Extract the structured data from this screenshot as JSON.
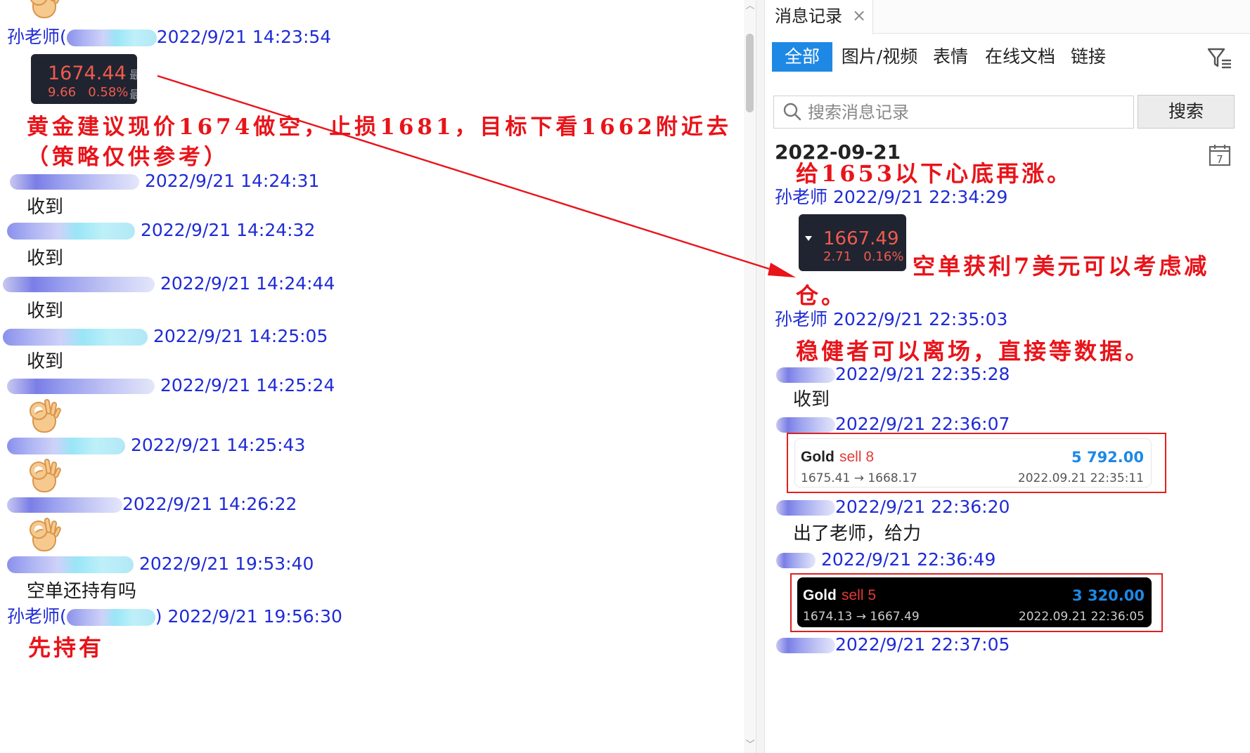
{
  "left_chat": {
    "messages": [
      {
        "sender": "孙老师(",
        "sender_tail": ")",
        "time": "2022/9/21 14:23:54"
      },
      {
        "sender": "",
        "time": "2022/9/21 14:24:31",
        "text": "收到"
      },
      {
        "sender": "",
        "time": "2022/9/21 14:24:32",
        "text": "收到"
      },
      {
        "sender": "",
        "time": "2022/9/21 14:24:44",
        "text": "收到"
      },
      {
        "sender": "",
        "time": "2022/9/21 14:25:05",
        "text": "收到"
      },
      {
        "sender": "",
        "time": "2022/9/21 14:25:24"
      },
      {
        "sender": "",
        "time": "2022/9/21 14:25:43"
      },
      {
        "sender": "",
        "time": "2022/9/21 14:26:22"
      },
      {
        "sender": "",
        "time": "2022/9/21 19:53:40",
        "text": "空单还持有吗"
      },
      {
        "sender": "孙老师(",
        "sender_tail": ")",
        "time": "2022/9/21 19:56:30"
      }
    ],
    "quote": {
      "price": "1674.44",
      "change": "9.66",
      "percent": "0.58%",
      "side_char": "最"
    },
    "advice_line1": "黄金建议现价1674做空，止损1681，目标下看1662附近去",
    "advice_line2": "（策略仅供参考）",
    "hold_text": "先持有"
  },
  "right_panel": {
    "tab_title": "消息记录",
    "filter_tabs": [
      "全部",
      "图片/视频",
      "表情",
      "在线文档",
      "链接"
    ],
    "search_placeholder": "搜索消息记录",
    "search_button": "搜索",
    "date_heading": "2022-09-21",
    "calendar_day": "7",
    "messages": [
      {
        "text": "给1653以下心底再涨。"
      },
      {
        "sender": "孙老师",
        "time": "2022/9/21 22:34:29"
      },
      {
        "sender": "孙老师",
        "time": "2022/9/21 22:35:03"
      },
      {
        "sender": "",
        "time": "2022/9/21 22:35:28",
        "text": "收到"
      },
      {
        "sender": "",
        "time": "2022/9/21 22:36:07"
      },
      {
        "sender": "",
        "time": "2022/9/21 22:36:20",
        "text": "出了老师，给力"
      },
      {
        "sender": "",
        "time": "2022/9/21 22:36:49"
      },
      {
        "sender": "",
        "time": "2022/9/21 22:37:05"
      }
    ],
    "quote": {
      "price": "1667.49",
      "change": "2.71",
      "percent": "0.16%"
    },
    "profit_line1": "空单获利7美元可以考虑减",
    "profit_line2": "仓。",
    "steady_text": "稳健者可以离场，直接等数据。",
    "trade_cards": [
      {
        "symbol": "Gold",
        "side": "sell 8",
        "profit": "5 792.00",
        "route": "1675.41 → 1668.17",
        "time": "2022.09.21 22:35:11",
        "theme": "light"
      },
      {
        "symbol": "Gold",
        "side": "sell 5",
        "profit": "3 320.00",
        "route": "1674.13 → 1667.49",
        "time": "2022.09.21 22:36:05",
        "theme": "dark"
      }
    ]
  },
  "colors": {
    "accent": "#1e88e5",
    "sender": "#1f2bd6",
    "annotation": "#e8141a",
    "quote_bg": "#1f2430",
    "quote_text": "#f05a4e"
  }
}
